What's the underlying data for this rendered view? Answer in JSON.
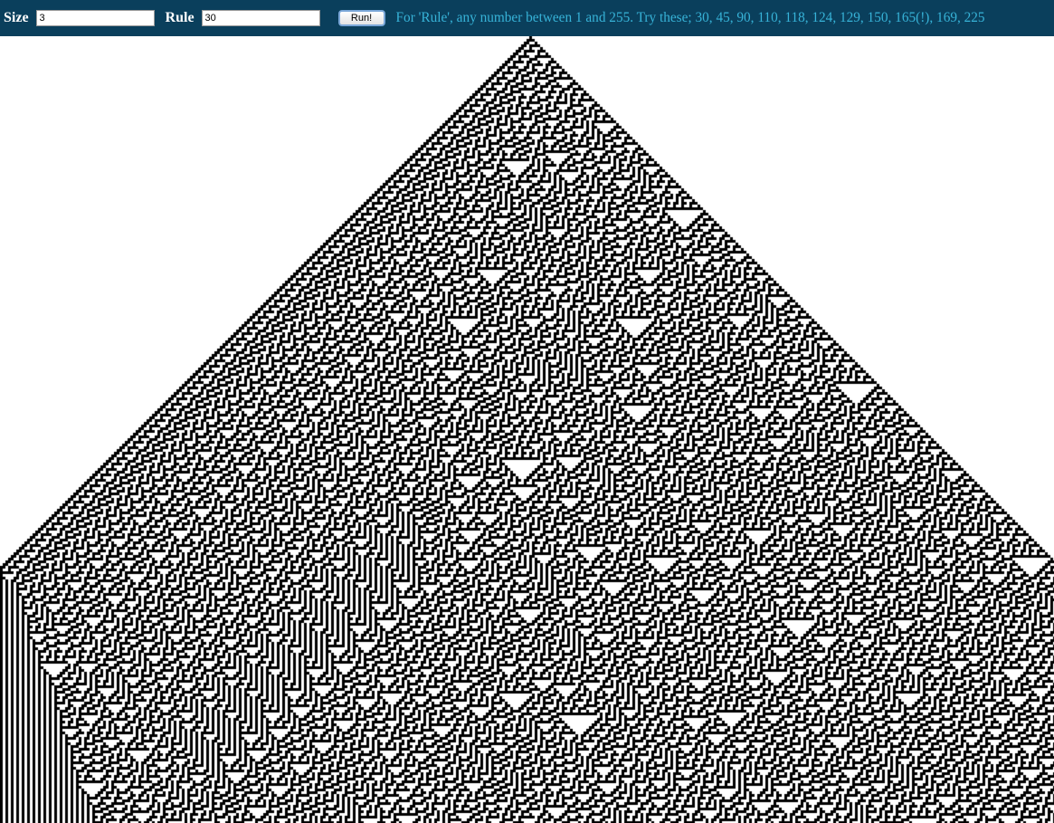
{
  "toolbar": {
    "size_label": "Size",
    "size_value": "3",
    "rule_label": "Rule",
    "rule_value": "30",
    "run_label": "Run!",
    "hint": "For 'Rule', any number between 1 and 255. Try these; 30, 45, 90, 110, 118, 124, 129, 150, 165(!), 169, 225"
  },
  "automaton": {
    "rule": 30,
    "cell_size": 3,
    "initial_state": "single black cell at center",
    "cell_color": "#000000",
    "background_color": "#ffffff"
  },
  "colors": {
    "toolbar_bg": "#0a3f5c",
    "label": "#ffffff",
    "hint": "#37b3d8"
  }
}
